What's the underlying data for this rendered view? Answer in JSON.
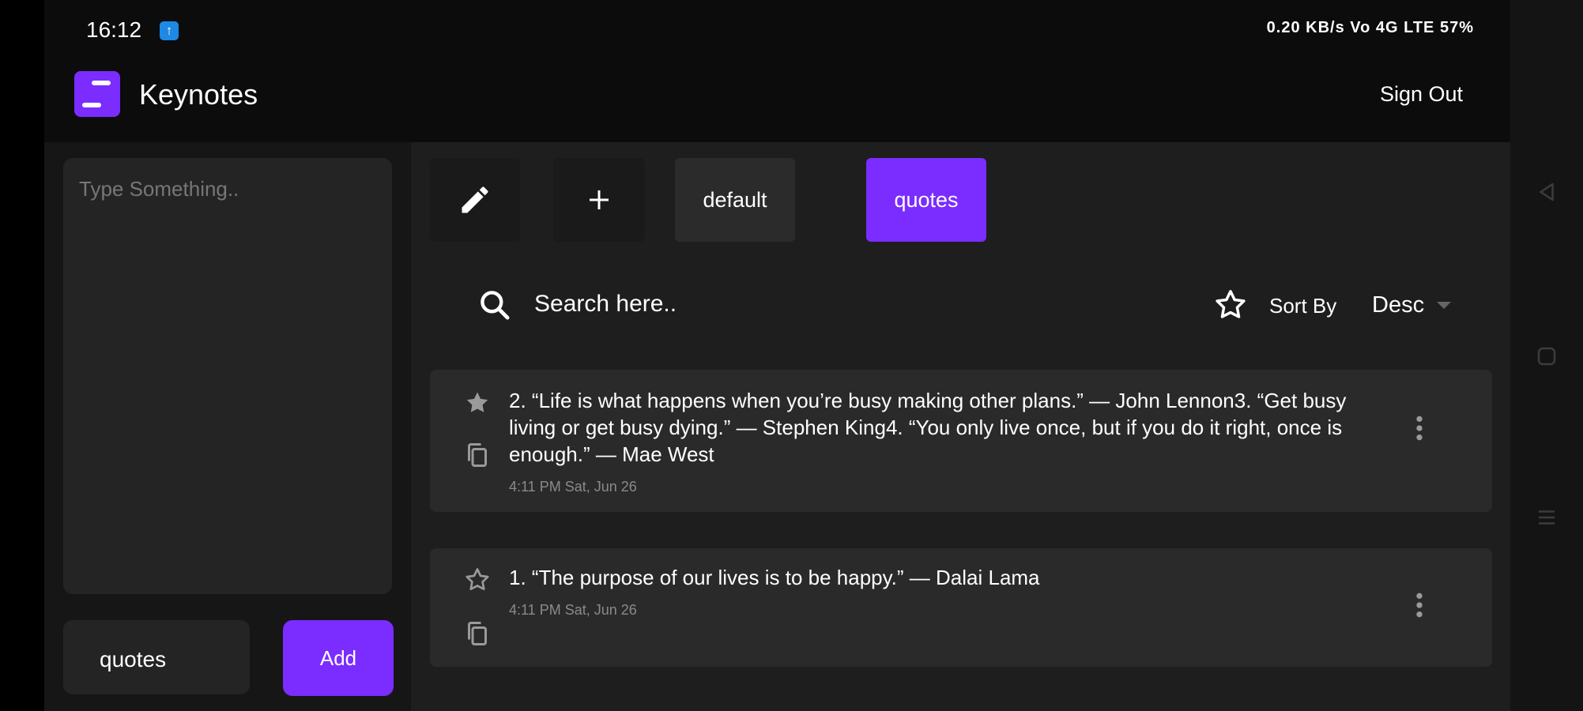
{
  "status_bar": {
    "time": "16:12",
    "notification_badge": "↑",
    "right_indicators": "0.20 KB/s  Vo  4G LTE  57%"
  },
  "header": {
    "app_name": "Keynotes",
    "sign_out_label": "Sign Out",
    "logo_icon": "notes-logo-icon"
  },
  "editor": {
    "note_placeholder": "Type Something..",
    "note_value": "",
    "category_value": "quotes",
    "add_label": "Add"
  },
  "toolbar": {
    "edit_icon": "pencil-icon",
    "add_icon": "plus-icon",
    "categories": [
      {
        "label": "default",
        "active": false
      },
      {
        "label": "quotes",
        "active": true
      }
    ]
  },
  "filter": {
    "search_placeholder": "Search here..",
    "favorites_icon": "star-outline-icon",
    "sort_label": "Sort By",
    "sort_value": "Desc"
  },
  "notes": [
    {
      "text": "2. “Life is what happens when you’re busy making other plans.” — John Lennon3. “Get busy living or get busy dying.” — Stephen King4. “You only live once, but if you do it right, once is enough.” — Mae West",
      "date": "4:11 PM Sat, Jun 26",
      "starred": true
    },
    {
      "text": "1. “The purpose of our lives is to be happy.” — Dalai Lama",
      "date": "4:11 PM Sat, Jun 26",
      "starred": false
    }
  ],
  "colors": {
    "accent": "#7b2cff",
    "background": "#0c0c0c",
    "panel": "#1e1e1e",
    "card": "#2a2a2a"
  }
}
